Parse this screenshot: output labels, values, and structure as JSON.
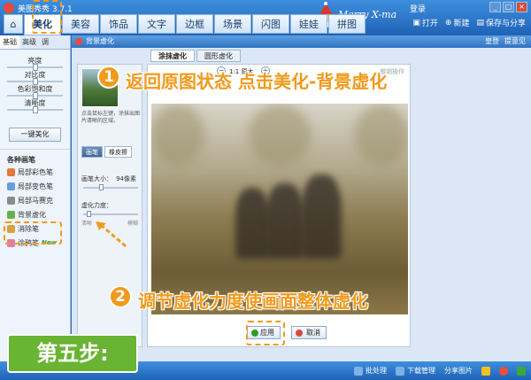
{
  "app": {
    "title": "美图秀秀 3.7.1",
    "login": "登录",
    "nav_tabs": [
      {
        "label": "美化",
        "active": true
      },
      {
        "label": "美容"
      },
      {
        "label": "饰品"
      },
      {
        "label": "文字"
      },
      {
        "label": "边框"
      },
      {
        "label": "场景"
      },
      {
        "label": "闪图"
      },
      {
        "label": "娃娃"
      },
      {
        "label": "拼图"
      }
    ],
    "top_tools": {
      "open": "打开",
      "new": "新建",
      "save": "保存与分享"
    },
    "xmas_badge": "Merry X-mas"
  },
  "left_panel": {
    "tabs": [
      "基础",
      "高级",
      "调"
    ],
    "sliders": [
      {
        "label": "亮度",
        "value": 0.5
      },
      {
        "label": "对比度",
        "value": 0.5
      },
      {
        "label": "色彩饱和度",
        "value": 0.5
      },
      {
        "label": "清晰度",
        "value": 0.5
      }
    ],
    "one_key_button": "一键美化",
    "brush_section_title": "各种画笔",
    "brushes": [
      {
        "label": "局部彩色笔",
        "color": "#e07a3a"
      },
      {
        "label": "局部变色笔",
        "color": "#6a9de0"
      },
      {
        "label": "局部马赛克",
        "color": "#8a8a8a"
      },
      {
        "label": "背景虚化",
        "color": "#6ab04a"
      },
      {
        "label": "消除笔",
        "color": "#d8a040"
      },
      {
        "label": "涂鸦笔",
        "color": "#e07ab0",
        "badge": "New"
      }
    ]
  },
  "dialog": {
    "title": "背景虚化",
    "header_right": [
      "皇登",
      "提意见"
    ],
    "subtabs": [
      {
        "label": "涂抹虚化",
        "active": true
      },
      {
        "label": "圆形虚化"
      }
    ],
    "hint": "点击鼠标左键，涂抹出图片清晰的区域。",
    "mode_tabs": [
      {
        "label": "画笔",
        "active": true
      },
      {
        "label": "橡皮擦"
      }
    ],
    "brush_size": {
      "label": "画笔大小：",
      "value": "94像素",
      "level": 0.3
    },
    "blur_strength": {
      "label": "虚化力度：",
      "min_label": "清晰",
      "max_label": "模糊",
      "level": 0.1
    },
    "zoom_label": "1:1 原大",
    "undo_label": "撤销操作",
    "ok_button": "应用",
    "cancel_button": "取消"
  },
  "statusbar": {
    "batch": "批处理",
    "download": "下载管理",
    "share": "分享图片"
  },
  "overlay": {
    "step1_num": "1",
    "step1_text": "返回原图状态 点击美化-背景虚化",
    "step2_num": "2",
    "step2_text": "调节虚化力度使画面整体虚化",
    "step_banner": "第五步:",
    "accent_color": "#f29a1c",
    "banner_color": "#69b432"
  }
}
